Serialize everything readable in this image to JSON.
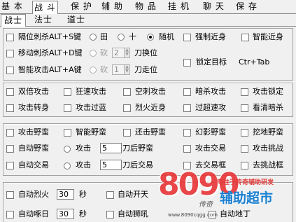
{
  "tabs": [
    "基 本",
    "战 斗",
    "保 护",
    "辅 助",
    "物 品",
    "挂 机",
    "聊 天",
    "保 存"
  ],
  "subtabs": [
    "战士",
    "法士",
    "道士"
  ],
  "group1": {
    "row1": {
      "label": "隔位刺杀ALT+S键",
      "opt1": "田",
      "opt2": "十",
      "opt3": "随机",
      "right1": "强制近身",
      "right2": "智能近身"
    },
    "row2": {
      "label": "移动刺杀ALT+D键",
      "opt1": "砍",
      "value": "2",
      "suffix": "刀换位"
    },
    "row3": {
      "label": "智能攻击ALT+A键",
      "opt1": "砍",
      "value": "1",
      "suffix": "刀走位",
      "right1": "锁定目标",
      "hotkey": "Ctr+Tab"
    }
  },
  "group2": {
    "row1": [
      "双倍攻击",
      "狂速攻击",
      "空刺攻击",
      "暗杀攻击",
      "攻击锁定"
    ],
    "row2": [
      "攻击转身",
      "攻击过蓝",
      "烈火近身",
      "过超速攻",
      "看清暗杀"
    ]
  },
  "group3": {
    "row1": [
      "攻击野蛮",
      "智能野蛮",
      "还击野蛮",
      "幻影野蛮",
      "挖地野蛮"
    ],
    "row2": {
      "label": "自动野蛮",
      "radio": "攻击",
      "value": "5",
      "suffix": "刀后野蛮",
      "c4": "攻击交易",
      "c5": "攻击挑战"
    },
    "row3": {
      "label": "自动交易",
      "radio": "攻击",
      "value": "5",
      "suffix": "刀后交易",
      "c4": "去交易框",
      "c5": "去挑战框"
    }
  },
  "group4": {
    "row1": {
      "label": "自动烈火",
      "value": "30",
      "unit": "秒",
      "label2": "自动开天"
    },
    "row2": {
      "label": "自动啄日",
      "value": "30",
      "unit": "秒",
      "label2": "自动狮吼",
      "label3": "自动地丁"
    }
  },
  "watermark": {
    "big": "8090",
    "slogan": "专注于传奇辅助研发",
    "title": "辅助超市",
    "url": "www.8090cqgg.com",
    "small": "传奇"
  }
}
